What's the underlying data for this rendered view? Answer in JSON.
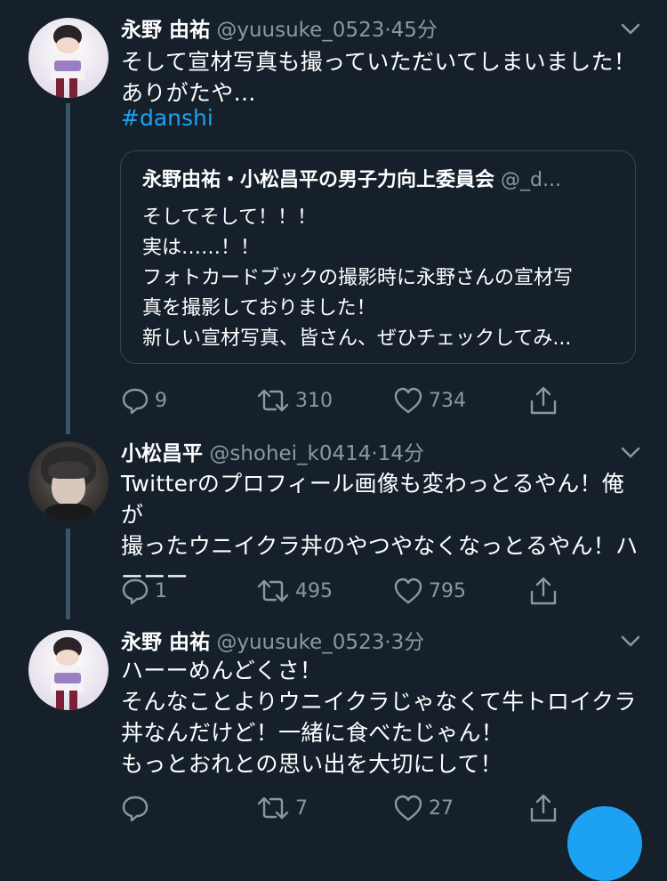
{
  "tweets": [
    {
      "name": "永野 由祐",
      "handle": "@yuusuke_0523",
      "time": "45分",
      "text": "そして宣材写真も撮っていただいてしまいました！\nありがたや…",
      "hashtag": "#danshi",
      "quote": {
        "name": "永野由祐・小松昌平の男子力向上委員会",
        "handle": "@_d...",
        "text": "そしてそして！！！\n実は……！！\nフォトカードブックの撮影時に永野さんの宣材写\n真を撮影しておりました！\n新しい宣材写真、皆さん、ぜひチェックしてみ..."
      },
      "replies": "9",
      "retweets": "310",
      "likes": "734"
    },
    {
      "name": "小松昌平",
      "handle": "@shohei_k0414",
      "time": "14分",
      "text": "Twitterのプロフィール画像も変わっとるやん！俺が\n撮ったウニイクラ丼のやつやなくなっとるやん！ハ\nーーー",
      "replies": "1",
      "retweets": "495",
      "likes": "795"
    },
    {
      "name": "永野 由祐",
      "handle": "@yuusuke_0523",
      "time": "3分",
      "text": "ハーーめんどくさ！\nそんなことよりウニイクラじゃなくて牛トロイクラ\n丼なんだけど！一緒に食べたじゃん！\nもっとおれとの思い出を大切にして！",
      "replies": "",
      "retweets": "7",
      "likes": "27"
    }
  ],
  "colors": {
    "background": "#15202b",
    "secondary_text": "#8899a6",
    "link": "#1da1f2",
    "thread_line": "#3d5466",
    "border": "#38444d"
  },
  "icons": [
    "reply-icon",
    "retweet-icon",
    "like-icon",
    "share-icon",
    "chevron-down-icon"
  ]
}
